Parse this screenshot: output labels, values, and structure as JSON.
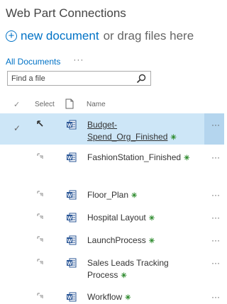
{
  "header": {
    "title": "Web Part Connections",
    "new_link": "new document",
    "new_rest": "or drag files here",
    "plus_icon": "plus-circle-icon"
  },
  "views": {
    "current": "All Documents",
    "more": "···"
  },
  "search": {
    "placeholder": "Find a file",
    "icon": "search-icon"
  },
  "columns": {
    "check": "✓",
    "select": "Select",
    "name": "Name"
  },
  "rows": [
    {
      "name": "Budget-Spend_Org_Finished",
      "selected": true,
      "new_badge": "✳",
      "more": "···"
    },
    {
      "name": "FashionStation_Finished",
      "selected": false,
      "new_badge": "✳",
      "more": "···"
    },
    {
      "name": "Floor_Plan",
      "selected": false,
      "new_badge": "✳",
      "more": "···"
    },
    {
      "name": "Hospital Layout",
      "selected": false,
      "new_badge": "✳",
      "more": "···"
    },
    {
      "name": "LaunchProcess",
      "selected": false,
      "new_badge": "✳",
      "more": "···"
    },
    {
      "name": "Sales Leads Tracking Process",
      "selected": false,
      "new_badge": "✳",
      "more": "···"
    },
    {
      "name": "Workflow",
      "selected": false,
      "new_badge": "✳",
      "more": "···"
    }
  ],
  "colors": {
    "accent": "#0072c6",
    "selected_row": "#cde6f7",
    "new_badge": "#2e8b2e"
  }
}
